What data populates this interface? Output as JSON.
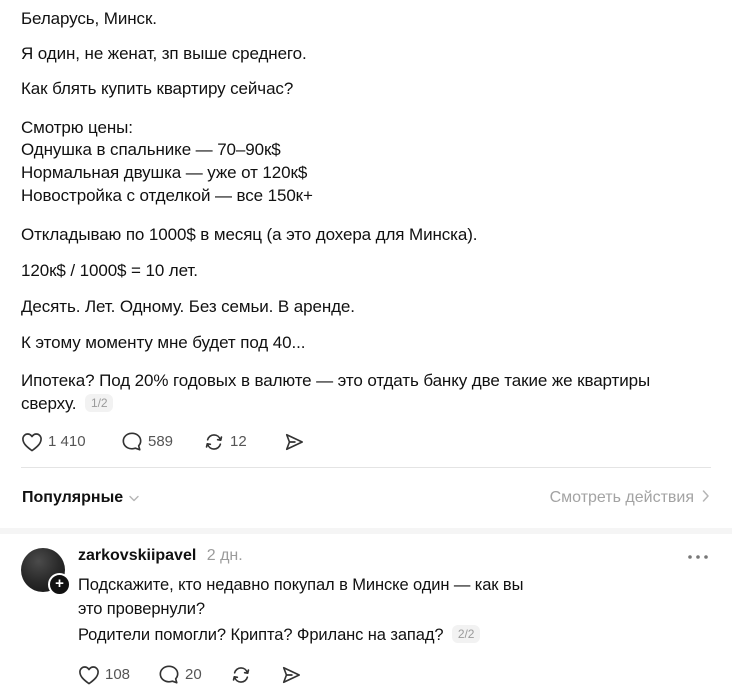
{
  "post": {
    "paragraphs": [
      "Беларусь, Минск.",
      "Я один, не женат, зп выше среднего.",
      "Как блять купить квартиру сейчас?",
      "Смотрю цены:",
      "Однушка в спальнике — 70–90к$",
      "Нормальная двушка — уже от 120к$",
      "Новостройка с отделкой — все 150к+",
      "Откладываю по 1000$ в месяц (а это дохера для Минска).",
      "120к$ / 1000$ = 10 лет.",
      "Десять. Лет. Одному. Без семьи. В аренде.",
      "К этому моменту мне будет под 40...",
      "Ипотека? Под 20% годовых в валюте — это отдать банку две такие же квартиры",
      "сверху."
    ],
    "pager": "1/2",
    "likes": "1 410",
    "replies": "589",
    "reposts": "12"
  },
  "section": {
    "sort_label": "Популярные",
    "activity_link": "Смотреть действия"
  },
  "comment": {
    "username": "zarkovskiipavel",
    "time": "2 дн.",
    "lines": [
      "Подскажите, кто недавно покупал в Минске один — как вы",
      "это провернули?",
      "Родители помогли? Крипта? Фриланс на запад?"
    ],
    "pager": "2/2",
    "likes": "108",
    "replies": "20"
  },
  "icons": {
    "like": "heart-icon",
    "reply": "comment-bubble-icon",
    "repost": "repost-arrows-icon",
    "share": "send-icon",
    "more": "ellipsis-icon",
    "chevron_down": "chevron-down-icon",
    "chevron_right": "chevron-right-icon",
    "follow": "plus-icon"
  },
  "colors": {
    "text": "#111111",
    "muted": "#9b9b9b",
    "divider": "#e4e4e4"
  }
}
